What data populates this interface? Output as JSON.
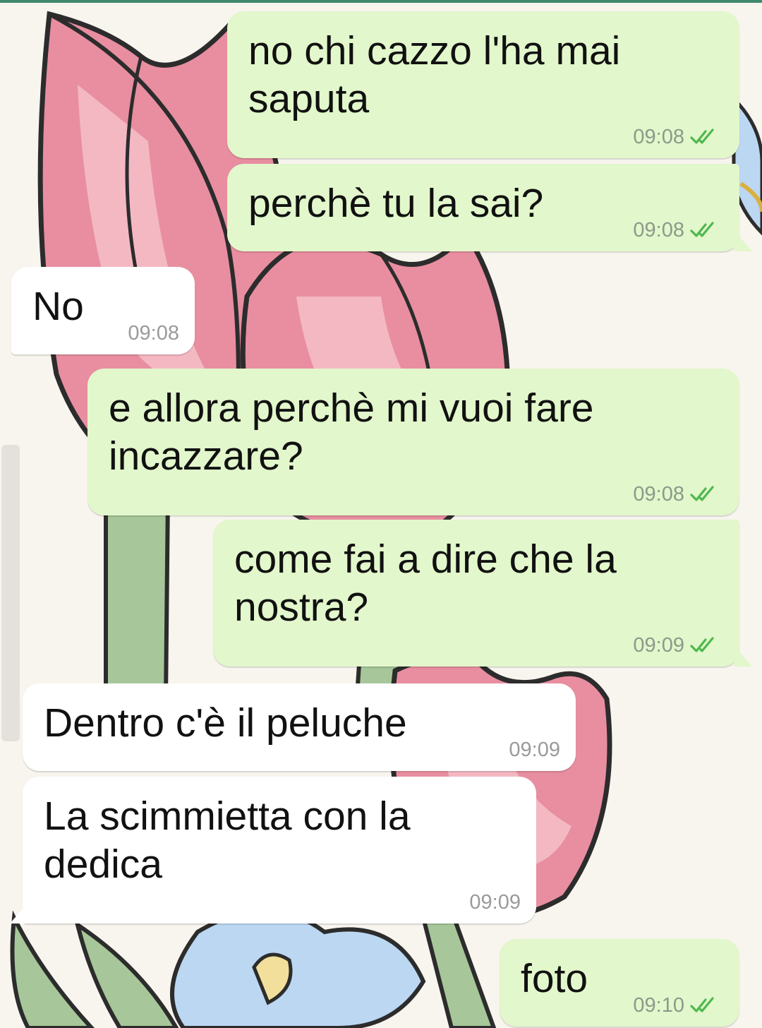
{
  "colors": {
    "outgoing_bubble": "#e2f7cb",
    "incoming_bubble": "#ffffff",
    "read_check": "#4fb84f",
    "top_accent": "#3f8a6e"
  },
  "wallpaper": {
    "subject": "pink tulips with green stems, blue flower",
    "icon": "tulip-wallpaper"
  },
  "messages": [
    {
      "direction": "outgoing",
      "text": "no chi cazzo l'ha mai saputa",
      "time": "09:08",
      "status": "read",
      "status_icon": "double-check-icon"
    },
    {
      "direction": "outgoing",
      "text": "perchè tu la sai?",
      "time": "09:08",
      "status": "read",
      "status_icon": "double-check-icon"
    },
    {
      "direction": "incoming",
      "text": "No",
      "time": "09:08"
    },
    {
      "direction": "outgoing",
      "text": "e allora perchè mi vuoi fare incazzare?",
      "time": "09:08",
      "status": "read",
      "status_icon": "double-check-icon"
    },
    {
      "direction": "outgoing",
      "text": "come fai a dire che la nostra?",
      "time": "09:09",
      "status": "read",
      "status_icon": "double-check-icon"
    },
    {
      "direction": "incoming",
      "text": "Dentro c'è il peluche",
      "time": "09:09"
    },
    {
      "direction": "incoming",
      "text": "La scimmietta con la dedica",
      "time": "09:09"
    },
    {
      "direction": "outgoing",
      "text": "foto",
      "time": "09:10",
      "status": "read",
      "status_icon": "double-check-icon"
    }
  ]
}
